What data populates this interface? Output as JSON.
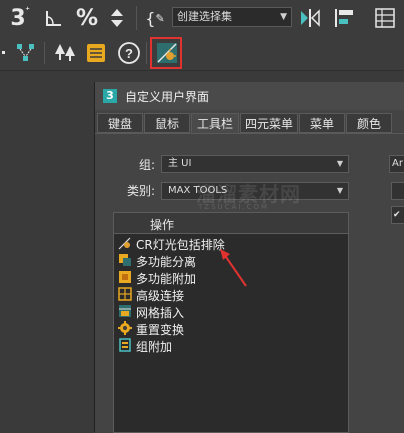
{
  "toolbar": {
    "snap_angle_label": "3",
    "percent_label": "%",
    "selection_set_value": "创建选择集"
  },
  "dialog": {
    "title": "自定义用户界面",
    "app_icon": "3",
    "tabs": [
      "键盘",
      "鼠标",
      "工具栏",
      "四元菜单",
      "菜单",
      "颜色"
    ],
    "active_tab": "工具栏",
    "group_label": "组:",
    "group_value": "主 UI",
    "category_label": "类别:",
    "category_value": "MAX TOOLS",
    "list_header": "操作",
    "right_partial": "Ar",
    "actions": [
      {
        "icon": "light-exclude-icon",
        "label": "CR灯光包括排除",
        "color": "#e0a030"
      },
      {
        "icon": "split-icon",
        "label": "多功能分离",
        "color": "#e8a820"
      },
      {
        "icon": "attach-icon",
        "label": "多功能附加",
        "color": "#e8a820"
      },
      {
        "icon": "advanced-connect-icon",
        "label": "高级连接",
        "color": "#e8a820"
      },
      {
        "icon": "mesh-insert-icon",
        "label": "网格插入",
        "color": "#e8a820"
      },
      {
        "icon": "reset-transform-icon",
        "label": "重置变换",
        "color": "#e8a820"
      },
      {
        "icon": "group-attach-icon",
        "label": "组附加",
        "color": "#4ac0c0"
      }
    ]
  },
  "watermark": {
    "main": "溜溜素材网",
    "sub": "TZSUCAI.COM"
  },
  "colors": {
    "highlight_border": "#e0322f",
    "arrow": "#e0322f"
  }
}
